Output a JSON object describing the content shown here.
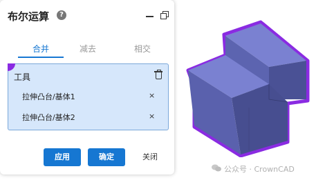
{
  "panel": {
    "title": "布尔运算",
    "help_icon": "question-circle-icon",
    "help_glyph": "?",
    "minimize_icon": "minimize-icon",
    "restore_icon": "restore-window-icon"
  },
  "tabs": [
    {
      "label": "合并",
      "active": true
    },
    {
      "label": "减去",
      "active": false
    },
    {
      "label": "相交",
      "active": false
    }
  ],
  "tools": {
    "label": "工具",
    "delete_icon": "trash-icon",
    "items": [
      {
        "label": "拉伸凸台/基体1",
        "remove_glyph": "×"
      },
      {
        "label": "拉伸凸台/基体2",
        "remove_glyph": "×"
      }
    ]
  },
  "buttons": {
    "apply": "应用",
    "confirm": "确定",
    "close": "关闭"
  },
  "watermark": {
    "text": "公众号 · CrownCAD",
    "icon": "wechat-icon"
  },
  "colors": {
    "accent": "#1677d2",
    "selection_highlight": "#8a2be2",
    "tools_background": "#d6e7fb",
    "solid_face": "#5f66b3"
  }
}
